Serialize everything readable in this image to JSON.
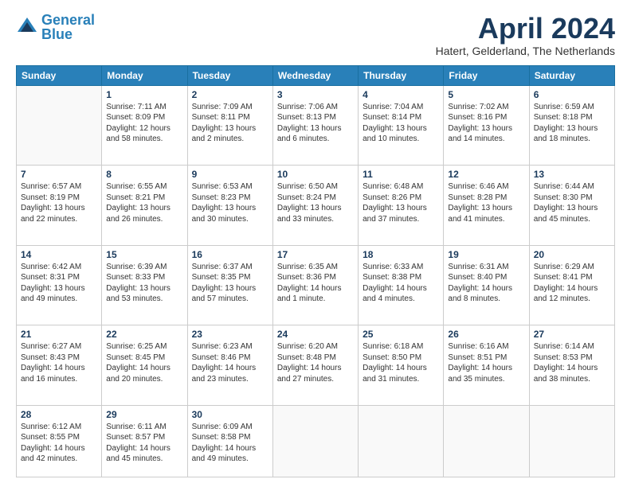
{
  "logo": {
    "line1": "General",
    "line2": "Blue"
  },
  "title": "April 2024",
  "location": "Hatert, Gelderland, The Netherlands",
  "days_of_week": [
    "Sunday",
    "Monday",
    "Tuesday",
    "Wednesday",
    "Thursday",
    "Friday",
    "Saturday"
  ],
  "weeks": [
    [
      {
        "num": "",
        "info": ""
      },
      {
        "num": "1",
        "info": "Sunrise: 7:11 AM\nSunset: 8:09 PM\nDaylight: 12 hours\nand 58 minutes."
      },
      {
        "num": "2",
        "info": "Sunrise: 7:09 AM\nSunset: 8:11 PM\nDaylight: 13 hours\nand 2 minutes."
      },
      {
        "num": "3",
        "info": "Sunrise: 7:06 AM\nSunset: 8:13 PM\nDaylight: 13 hours\nand 6 minutes."
      },
      {
        "num": "4",
        "info": "Sunrise: 7:04 AM\nSunset: 8:14 PM\nDaylight: 13 hours\nand 10 minutes."
      },
      {
        "num": "5",
        "info": "Sunrise: 7:02 AM\nSunset: 8:16 PM\nDaylight: 13 hours\nand 14 minutes."
      },
      {
        "num": "6",
        "info": "Sunrise: 6:59 AM\nSunset: 8:18 PM\nDaylight: 13 hours\nand 18 minutes."
      }
    ],
    [
      {
        "num": "7",
        "info": "Sunrise: 6:57 AM\nSunset: 8:19 PM\nDaylight: 13 hours\nand 22 minutes."
      },
      {
        "num": "8",
        "info": "Sunrise: 6:55 AM\nSunset: 8:21 PM\nDaylight: 13 hours\nand 26 minutes."
      },
      {
        "num": "9",
        "info": "Sunrise: 6:53 AM\nSunset: 8:23 PM\nDaylight: 13 hours\nand 30 minutes."
      },
      {
        "num": "10",
        "info": "Sunrise: 6:50 AM\nSunset: 8:24 PM\nDaylight: 13 hours\nand 33 minutes."
      },
      {
        "num": "11",
        "info": "Sunrise: 6:48 AM\nSunset: 8:26 PM\nDaylight: 13 hours\nand 37 minutes."
      },
      {
        "num": "12",
        "info": "Sunrise: 6:46 AM\nSunset: 8:28 PM\nDaylight: 13 hours\nand 41 minutes."
      },
      {
        "num": "13",
        "info": "Sunrise: 6:44 AM\nSunset: 8:30 PM\nDaylight: 13 hours\nand 45 minutes."
      }
    ],
    [
      {
        "num": "14",
        "info": "Sunrise: 6:42 AM\nSunset: 8:31 PM\nDaylight: 13 hours\nand 49 minutes."
      },
      {
        "num": "15",
        "info": "Sunrise: 6:39 AM\nSunset: 8:33 PM\nDaylight: 13 hours\nand 53 minutes."
      },
      {
        "num": "16",
        "info": "Sunrise: 6:37 AM\nSunset: 8:35 PM\nDaylight: 13 hours\nand 57 minutes."
      },
      {
        "num": "17",
        "info": "Sunrise: 6:35 AM\nSunset: 8:36 PM\nDaylight: 14 hours\nand 1 minute."
      },
      {
        "num": "18",
        "info": "Sunrise: 6:33 AM\nSunset: 8:38 PM\nDaylight: 14 hours\nand 4 minutes."
      },
      {
        "num": "19",
        "info": "Sunrise: 6:31 AM\nSunset: 8:40 PM\nDaylight: 14 hours\nand 8 minutes."
      },
      {
        "num": "20",
        "info": "Sunrise: 6:29 AM\nSunset: 8:41 PM\nDaylight: 14 hours\nand 12 minutes."
      }
    ],
    [
      {
        "num": "21",
        "info": "Sunrise: 6:27 AM\nSunset: 8:43 PM\nDaylight: 14 hours\nand 16 minutes."
      },
      {
        "num": "22",
        "info": "Sunrise: 6:25 AM\nSunset: 8:45 PM\nDaylight: 14 hours\nand 20 minutes."
      },
      {
        "num": "23",
        "info": "Sunrise: 6:23 AM\nSunset: 8:46 PM\nDaylight: 14 hours\nand 23 minutes."
      },
      {
        "num": "24",
        "info": "Sunrise: 6:20 AM\nSunset: 8:48 PM\nDaylight: 14 hours\nand 27 minutes."
      },
      {
        "num": "25",
        "info": "Sunrise: 6:18 AM\nSunset: 8:50 PM\nDaylight: 14 hours\nand 31 minutes."
      },
      {
        "num": "26",
        "info": "Sunrise: 6:16 AM\nSunset: 8:51 PM\nDaylight: 14 hours\nand 35 minutes."
      },
      {
        "num": "27",
        "info": "Sunrise: 6:14 AM\nSunset: 8:53 PM\nDaylight: 14 hours\nand 38 minutes."
      }
    ],
    [
      {
        "num": "28",
        "info": "Sunrise: 6:12 AM\nSunset: 8:55 PM\nDaylight: 14 hours\nand 42 minutes."
      },
      {
        "num": "29",
        "info": "Sunrise: 6:11 AM\nSunset: 8:57 PM\nDaylight: 14 hours\nand 45 minutes."
      },
      {
        "num": "30",
        "info": "Sunrise: 6:09 AM\nSunset: 8:58 PM\nDaylight: 14 hours\nand 49 minutes."
      },
      {
        "num": "",
        "info": ""
      },
      {
        "num": "",
        "info": ""
      },
      {
        "num": "",
        "info": ""
      },
      {
        "num": "",
        "info": ""
      }
    ]
  ]
}
